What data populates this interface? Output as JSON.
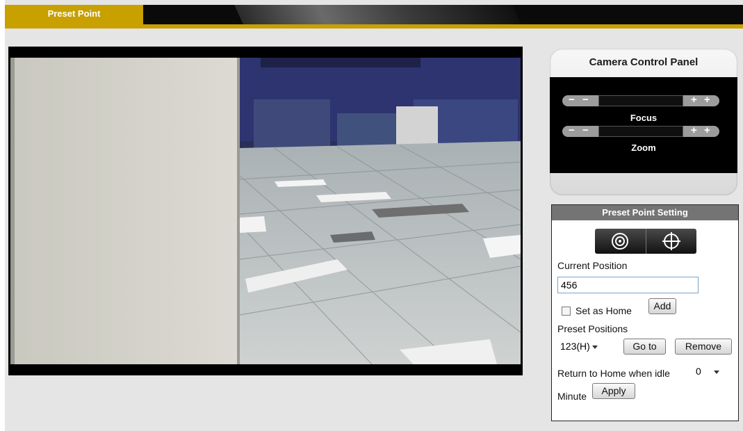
{
  "header": {
    "active_tab": "Preset Point"
  },
  "camera_control": {
    "title": "Camera Control Panel",
    "focus_label": "Focus",
    "zoom_label": "Zoom"
  },
  "preset_setting": {
    "title": "Preset Point Setting",
    "current_position_label": "Current Position",
    "current_position_value": "456",
    "set_as_home_label": "Set as Home",
    "set_as_home_checked": false,
    "add_label": "Add",
    "preset_positions_label": "Preset Positions",
    "preset_selected": "123(H)",
    "goto_label": "Go to",
    "remove_label": "Remove",
    "return_home_label": "Return to Home when idle",
    "idle_value": "0",
    "minute_label": "Minute",
    "apply_label": "Apply"
  },
  "colors": {
    "accent": "#c8a000",
    "panel_dark": "#000000",
    "title_bar": "#747474"
  }
}
